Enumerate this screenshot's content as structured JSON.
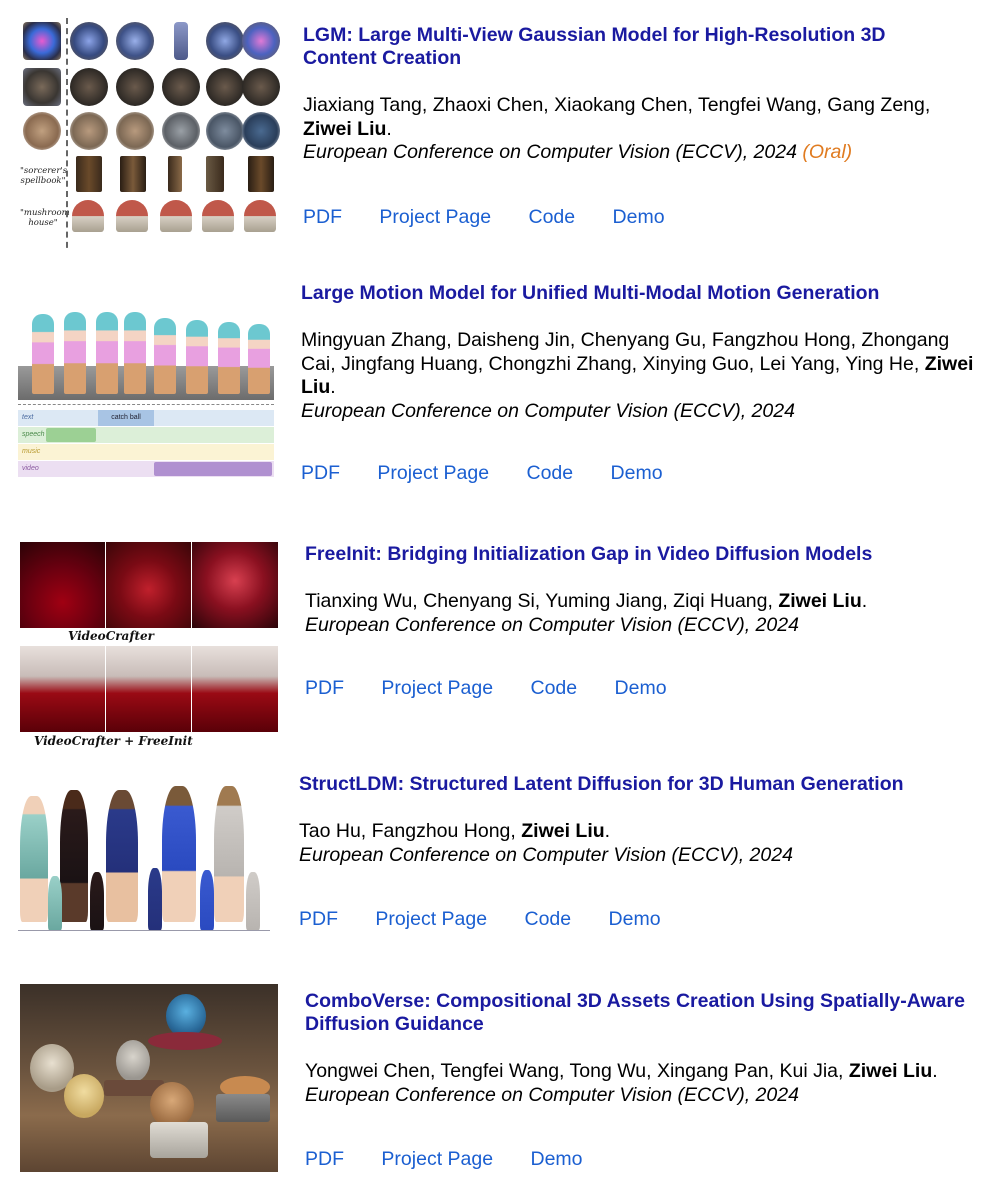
{
  "publications": [
    {
      "title": "LGM: Large Multi-View Gaussian Model for High-Resolution 3D Content Creation",
      "authors": "Jiaxiang Tang, Zhaoxi Chen, Xiaokang Chen, Tengfei Wang, Gang Zeng,",
      "highlight_author": "Ziwei Liu",
      "authors_end": ".",
      "venue": "European Conference on Computer Vision (ECCV), 2024",
      "badge": "(Oral)",
      "links": [
        "PDF",
        "Project Page",
        "Code",
        "Demo"
      ],
      "thumb_labels": [
        "\"sorcerer's spellbook\"",
        "\"mushroom house\""
      ]
    },
    {
      "title": "Large Motion Model for Unified Multi-Modal Motion Generation",
      "authors": "Mingyuan Zhang, Daisheng Jin, Chenyang Gu, Fangzhou Hong, Zhongang Cai, Jingfang Huang, Chongzhi Zhang, Xinying Guo, Lei Yang, Ying He,",
      "highlight_author": "Ziwei Liu",
      "authors_end": ".",
      "venue": "European Conference on Computer Vision (ECCV), 2024",
      "links": [
        "PDF",
        "Project Page",
        "Code",
        "Demo"
      ],
      "thumb_tracks": [
        "text",
        "speech",
        "music",
        "video"
      ],
      "thumb_caption": "catch ball"
    },
    {
      "title": "FreeInit: Bridging Initialization Gap in Video Diffusion Models",
      "authors": "Tianxing Wu, Chenyang Si, Yuming Jiang, Ziqi Huang,",
      "highlight_author": "Ziwei Liu",
      "authors_end": ".",
      "venue": "European Conference on Computer Vision (ECCV), 2024",
      "links": [
        "PDF",
        "Project Page",
        "Code",
        "Demo"
      ],
      "thumb_labels": [
        "VideoCrafter",
        "VideoCrafter + FreeInit"
      ]
    },
    {
      "title": "StructLDM: Structured Latent Diffusion for 3D Human Generation",
      "authors": "Tao Hu, Fangzhou Hong,",
      "highlight_author": "Ziwei Liu",
      "authors_end": ".",
      "venue": "European Conference on Computer Vision (ECCV), 2024",
      "links": [
        "PDF",
        "Project Page",
        "Code",
        "Demo"
      ]
    },
    {
      "title": "ComboVerse: Compositional 3D Assets Creation Using Spatially-Aware Diffusion Guidance",
      "authors": "Yongwei Chen, Tengfei Wang, Tong Wu, Xingang Pan, Kui Jia,",
      "highlight_author": "Ziwei Liu",
      "authors_end": ".",
      "venue": "European Conference on Computer Vision (ECCV), 2024",
      "links": [
        "PDF",
        "Project Page",
        "Demo"
      ]
    }
  ],
  "colors": {
    "title": "#1a1aa0",
    "link": "#1b5fd1",
    "oral": "#e07b20"
  }
}
